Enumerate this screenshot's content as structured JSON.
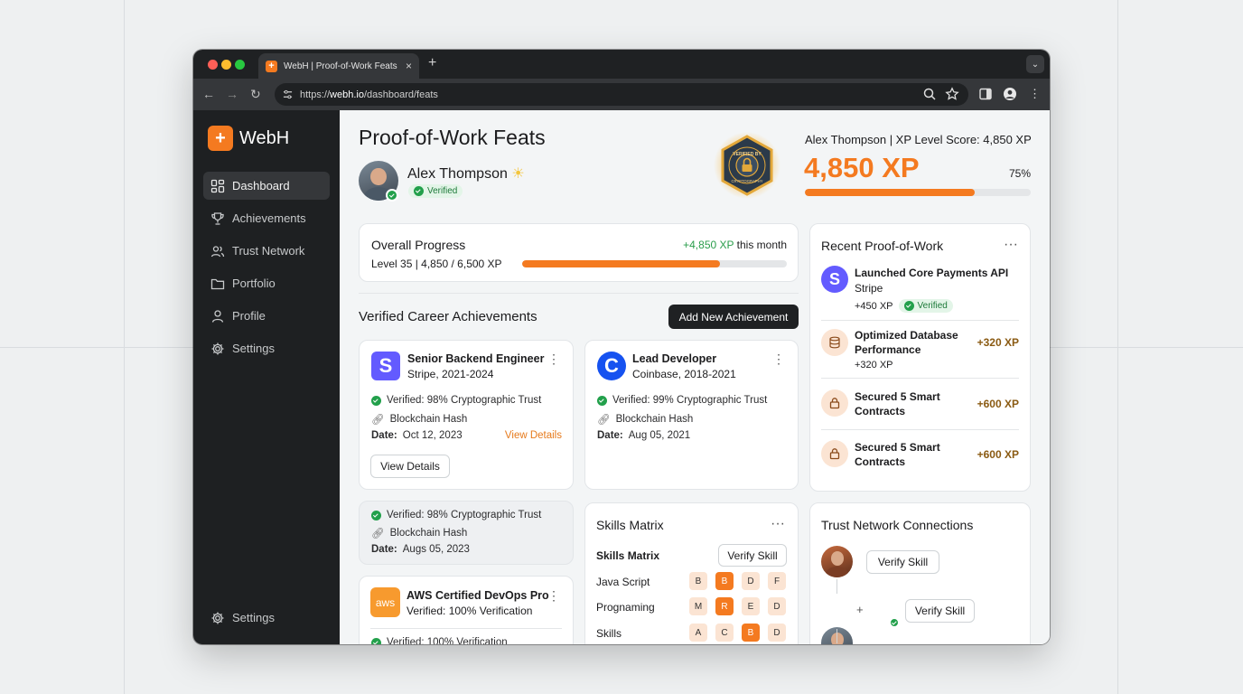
{
  "browser": {
    "tab_title": "WebH | Proof-of-Work Feats",
    "url_scheme": "https://",
    "url_host": "webh.io",
    "url_path": "/dashboard/feats"
  },
  "sidebar": {
    "brand": "WebH",
    "items": [
      {
        "label": "Dashboard",
        "icon": "grid-icon"
      },
      {
        "label": "Achievements",
        "icon": "trophy-icon"
      },
      {
        "label": "Trust Network",
        "icon": "users-icon"
      },
      {
        "label": "Portfolio",
        "icon": "folder-icon"
      },
      {
        "label": "Profile",
        "icon": "user-icon"
      },
      {
        "label": "Settings",
        "icon": "gear-icon"
      }
    ],
    "bottom": "Settings"
  },
  "header": {
    "title": "Proof-of-Work Feats",
    "user_name": "Alex Thompson",
    "verified": "Verified",
    "seal_text": "VERIFIED BY CRYPTOGRAPHY",
    "score_label": "Alex Thompson | XP Level Score: 4,850 XP",
    "xp": "4,850 XP",
    "xp_percent": "75%",
    "xp_fraction": 0.75
  },
  "progress": {
    "title": "Overall Progress",
    "level": "Level 35 | 4,850 / 6,500 XP",
    "delta": "+4,850 XP",
    "delta_suffix": "this month",
    "fraction": 0.746
  },
  "achievements": {
    "title": "Verified Career Achievements",
    "add_button": "Add New Achievement",
    "cards": [
      {
        "logo": "S",
        "role": "Senior Backend Engineer",
        "org": "Stripe, 2021-2024",
        "trust": "Verified: 98% Cryptographic Trust",
        "hash": "Blockchain Hash",
        "date_label": "Date:",
        "date": "Oct 12, 2023",
        "link": "View Details",
        "button": "View Details"
      },
      {
        "logo": "C",
        "role": "Lead Developer",
        "org": "Coinbase, 2018-2021",
        "trust": "Verified: 99% Cryptographic Trust",
        "hash": "Blockchain Hash",
        "date_label": "Date:",
        "date": "Aug 05, 2021"
      }
    ],
    "extra": {
      "trust": "Verified: 98% Cryptographic Trust",
      "hash": "Blockchain Hash",
      "date_label": "Date:",
      "date": "Augs 05, 2023"
    },
    "aws": {
      "logo": "aws",
      "role": "AWS Certified DevOps Pro",
      "sub": "Verified: 100% Verification",
      "partial": "Verified: 100% Verification"
    }
  },
  "recent": {
    "title": "Recent Proof-of-Work",
    "items": [
      {
        "title": "Launched Core Payments API",
        "sub": "Stripe",
        "xp": "+450 XP",
        "badge": "Verified"
      },
      {
        "title": "Optimized Database Performance",
        "xp": "+320 XP",
        "sub_xp": "+320 XP"
      },
      {
        "title": "Secured 5 Smart Contracts",
        "xp": "+600 XP"
      },
      {
        "title": "Secured 5 Smart Contracts",
        "xp": "+600 XP"
      }
    ]
  },
  "skills": {
    "title": "Skills Matrix",
    "subtitle": "Skills Matrix",
    "verify": "Verify Skill",
    "rows": [
      {
        "name": "Java Script",
        "cells": [
          "B",
          "B",
          "D",
          "F"
        ],
        "active": 1
      },
      {
        "name": "Prognaming",
        "cells": [
          "M",
          "R",
          "E",
          "D"
        ],
        "active": 1
      },
      {
        "name": "Skills",
        "cells": [
          "A",
          "C",
          "B",
          "D"
        ],
        "active": 2
      }
    ]
  },
  "trust": {
    "title": "Trust Network Connections",
    "verify1": "Verify Skill",
    "verify2": "Verify Skill",
    "plus": "+"
  },
  "colors": {
    "accent": "#f47a20",
    "dark": "#1f2123",
    "verified_green": "#22a04b"
  }
}
